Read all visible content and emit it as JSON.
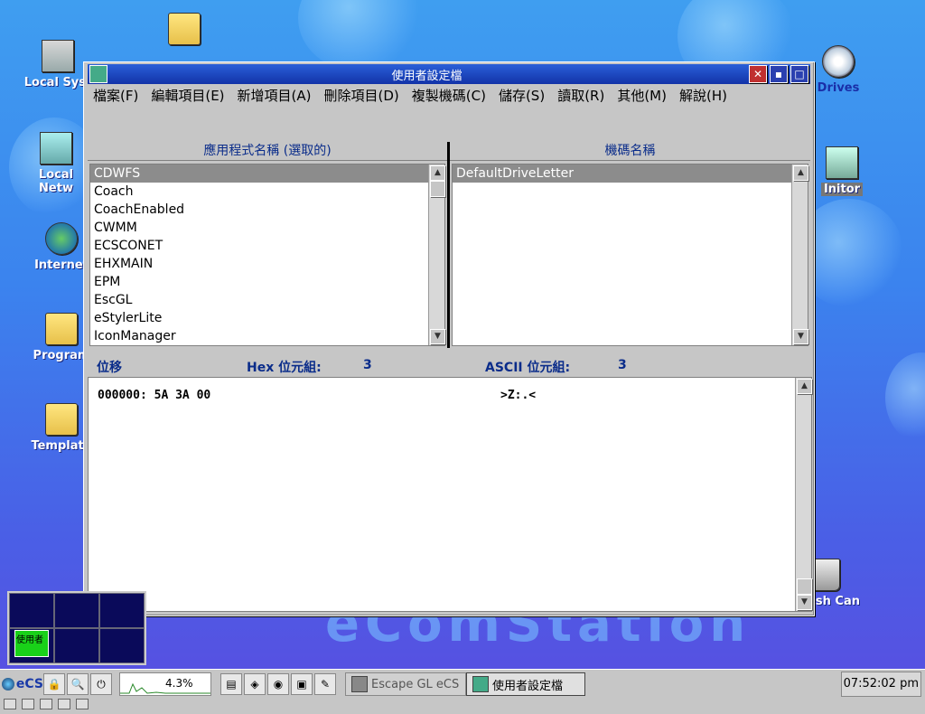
{
  "desktop": {
    "icons": [
      {
        "name": "local-system-icon",
        "label": "Local Syst"
      },
      {
        "name": "local-network-icon",
        "label": "Local Netw"
      },
      {
        "name": "internet-icon",
        "label": "Internet"
      },
      {
        "name": "programs-icon",
        "label": "Program"
      },
      {
        "name": "templates-icon",
        "label": "Template"
      },
      {
        "name": "drives-icon",
        "label": "Drives"
      },
      {
        "name": "monitor-icon",
        "label": "Initor"
      },
      {
        "name": "trash-icon",
        "label": "sh Can"
      }
    ],
    "logo": "eComStation"
  },
  "window": {
    "title": "使用者設定檔",
    "menu": [
      "檔案(F)",
      "編輯項目(E)",
      "新增項目(A)",
      "刪除項目(D)",
      "複製機碼(C)",
      "儲存(S)",
      "讀取(R)",
      "其他(M)",
      "解說(H)"
    ],
    "left_pane": {
      "header": "應用程式名稱 (選取的)",
      "items": [
        "CDWFS",
        "Coach",
        "CoachEnabled",
        "CWMM",
        "ECSCONET",
        "EHXMAIN",
        "EPM",
        "EscGL",
        "eStylerLite",
        "IconManager"
      ],
      "selected": "CDWFS"
    },
    "right_pane": {
      "header": "機碼名稱",
      "items": [
        "DefaultDriveLetter"
      ],
      "selected": "DefaultDriveLetter"
    },
    "info": {
      "offset_label": "位移",
      "hex_label": "Hex 位元組:",
      "hex_count": "3",
      "ascii_label": "ASCII 位元組:",
      "ascii_count": "3"
    },
    "hex": {
      "line": "000000: 5A 3A 00",
      "ascii": ">Z:.<"
    }
  },
  "pager": {
    "window_label": "使用者"
  },
  "taskbar": {
    "start_label": "eCS",
    "cpu_load": "4.3%",
    "tasks": [
      {
        "label": "Escape GL eCS",
        "active": false
      },
      {
        "label": "使用者設定檔",
        "active": true
      }
    ],
    "clock": "07:52:02 pm"
  }
}
